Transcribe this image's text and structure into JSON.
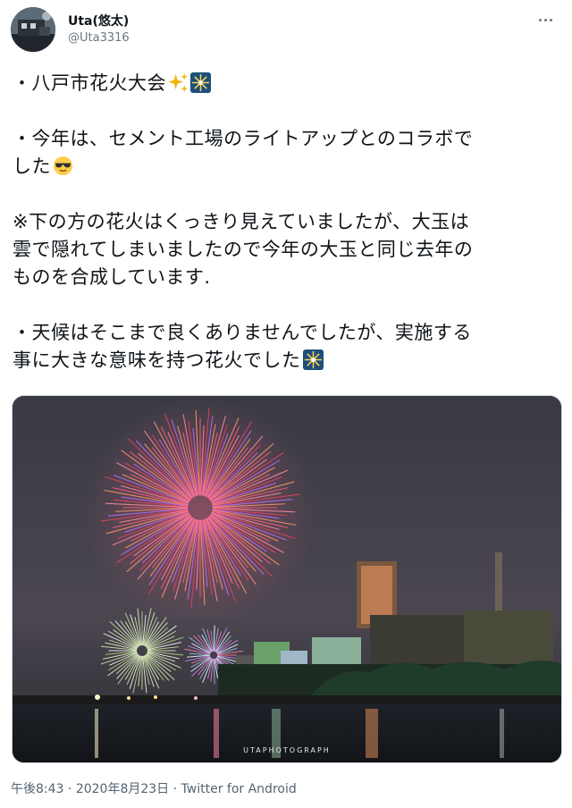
{
  "user": {
    "display_name": "Uta(悠太)",
    "handle": "@Uta3316",
    "avatar_icon": "avatar-photo"
  },
  "tweet": {
    "paragraphs": [
      "・八戸市花火大会",
      "・今年は、セメント工場のライトアップとのコラボでした",
      "※下の方の花火はくっきり見えていましたが、大玉は雲で隠れてしまいましたので今年の大玉と同じ去年のものを合成しています.",
      "・天候はそこまで良くありませんでしたが、実施する事に大きな意味を持つ花火でした"
    ],
    "paragraph_lines": [
      [
        "・八戸市花火大会"
      ],
      [
        "・今年は、セメント工場のライトアップとのコラボで",
        "した"
      ],
      [
        "※下の方の花火はくっきり見えていましたが、大玉は",
        "雲で隠れてしまいましたので今年の大玉と同じ去年の",
        "ものを合成しています."
      ],
      [
        "・天候はそこまで良くありませんでしたが、実施する",
        "事に大きな意味を持つ花火でした"
      ]
    ],
    "emojis": [
      "sparkles-emoji",
      "fireworks-emoji",
      "sunglasses-emoji",
      "fireworks-emoji"
    ]
  },
  "media": {
    "description_icon": "fireworks-photo",
    "watermark": "UTAPHOTOGRAPH"
  },
  "footer": {
    "time": "午後8:43",
    "separator": "·",
    "date": "2020年8月23日",
    "source": "Twitter for Android"
  },
  "colors": {
    "text": "#0f1419",
    "secondary": "#536471",
    "border": "#cfd9de"
  }
}
